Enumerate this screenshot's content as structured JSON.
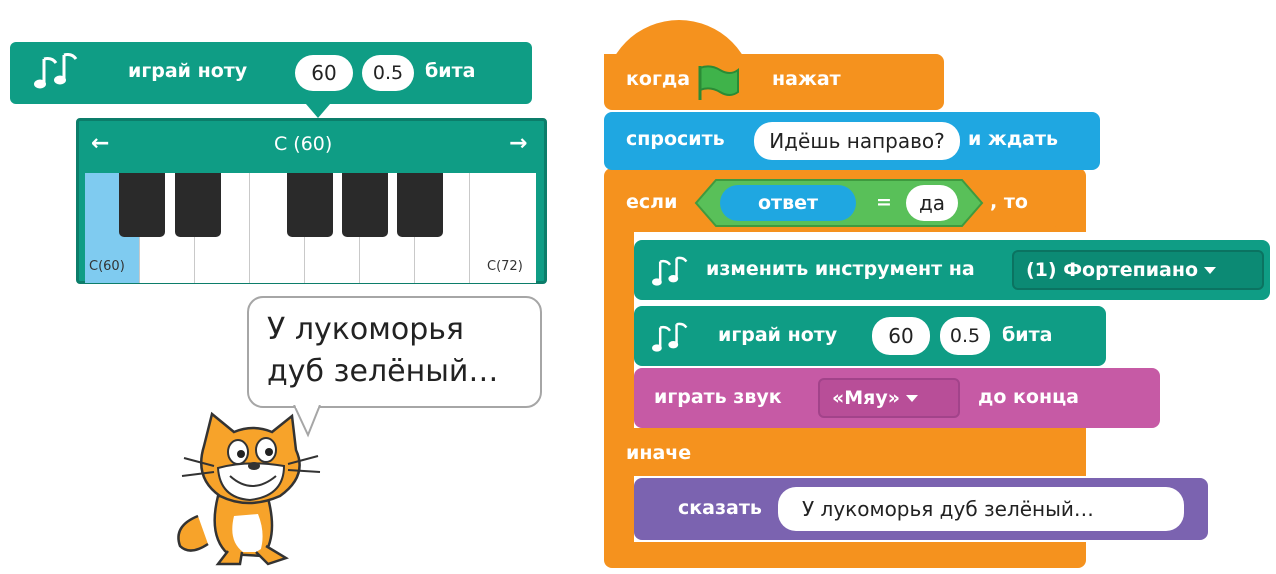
{
  "piano_block": {
    "label": "играй ноту",
    "note_value": "60",
    "beats_value": "0.5",
    "beats_label": "бита"
  },
  "piano": {
    "current_note": "C (60)",
    "left_key_label": "C(60)",
    "right_key_label": "C(72)",
    "left_arrow": "←",
    "right_arrow": "→"
  },
  "speech": {
    "line1": "У лукоморья",
    "line2": "дуб зелёный…"
  },
  "script": {
    "hat": {
      "when": "когда",
      "clicked": "нажат"
    },
    "ask": {
      "label": "спросить",
      "question": "Идёшь направо?",
      "wait": "и ждать"
    },
    "if": {
      "label": "если",
      "reporter": "ответ",
      "equals": "=",
      "value": "да",
      "then": ", то"
    },
    "instrument": {
      "label": "изменить инструмент на",
      "value": "(1) Фортепиано"
    },
    "play_note": {
      "label": "играй ноту",
      "note": "60",
      "beats": "0.5",
      "beats_label": "бита"
    },
    "sound": {
      "label": "играть звук",
      "value": "«Мяу»",
      "until": "до конца"
    },
    "else": {
      "label": "иначе"
    },
    "say": {
      "label": "сказать",
      "text": "У лукоморья дуб зелёный…"
    }
  },
  "colors": {
    "music": "#0f9d85",
    "music_dark": "#0c7d6a",
    "events": "#f5921e",
    "sensing": "#1fa7e1",
    "operators": "#59c059",
    "sound": "#c65aa5",
    "looks": "#7b63b0",
    "piano_selected": "#7fcbf0"
  },
  "icons": [
    "music-note-icon",
    "green-flag-icon",
    "dropdown-arrow-icon",
    "cat-sprite"
  ]
}
